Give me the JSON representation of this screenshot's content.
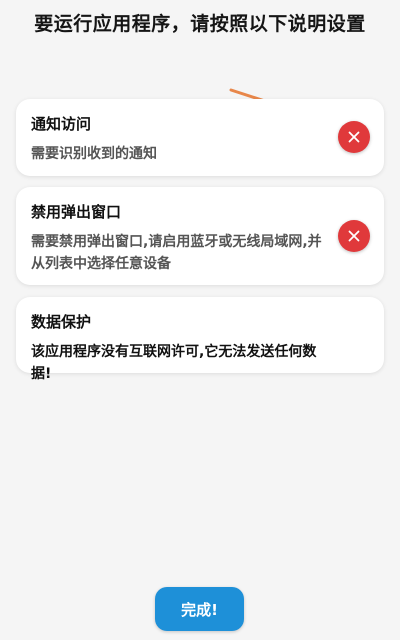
{
  "header": {
    "title": "要运行应用程序，请按照以下说明设置"
  },
  "cards": [
    {
      "title": "通知访问",
      "description": "需要识别收到的通知",
      "status_icon": "close-icon"
    },
    {
      "title": "禁用弹出窗口",
      "description": "需要禁用弹出窗口,请启用蓝牙或无线局域网,并从列表中选择任意设备",
      "status_icon": "close-icon"
    },
    {
      "title": "数据保护",
      "description": "该应用程序没有互联网许可,它无法发送任何数据!"
    }
  ],
  "footer": {
    "done_label": "完成!"
  },
  "colors": {
    "background": "#f5f5f5",
    "card": "#ffffff",
    "error_badge": "#e0393b",
    "primary_button": "#1e90d8",
    "annotation_arrow": "#e8874a"
  }
}
